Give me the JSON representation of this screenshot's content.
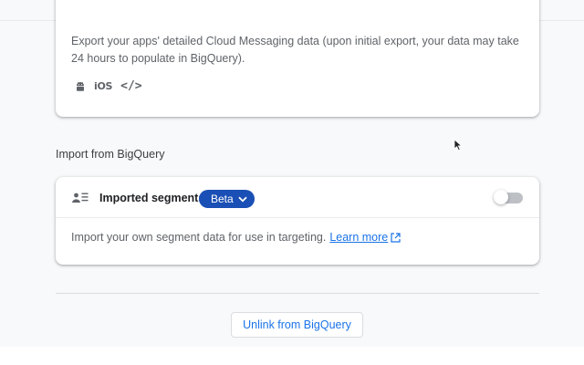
{
  "export_card": {
    "description": "Export your apps' detailed Cloud Messaging data (upon initial export, your data may take 24 hours to populate in BigQuery).",
    "platforms": [
      {
        "name": "android-icon"
      },
      {
        "label": "iOS"
      },
      {
        "label": "</>"
      }
    ]
  },
  "import_section": {
    "label": "Import from BigQuery"
  },
  "import_card": {
    "title": "Imported segments",
    "badge": "Beta",
    "toggle_on": false,
    "description": "Import your own segment data for use in targeting.",
    "learn_more": "Learn more"
  },
  "footer": {
    "unlink_label": "Unlink from BigQuery"
  },
  "colors": {
    "accent": "#1a73e8",
    "badge": "#1a4fb5",
    "page_bg": "#f8f9fa"
  }
}
